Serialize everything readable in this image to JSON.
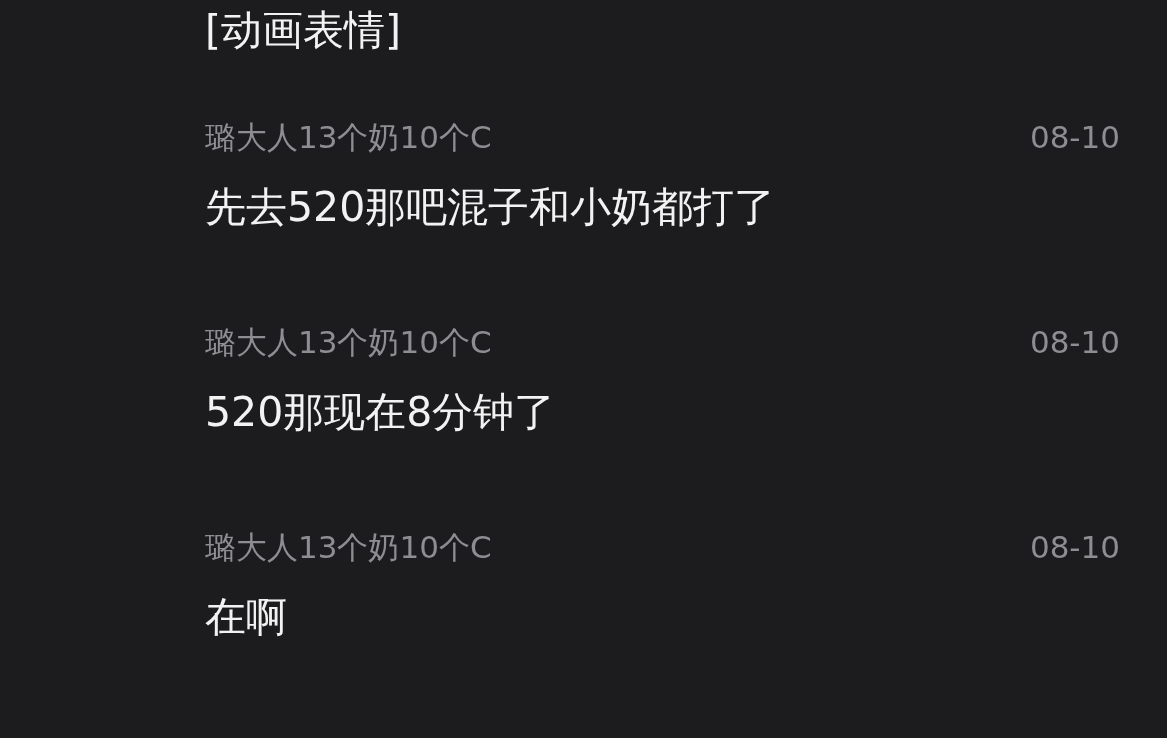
{
  "messages": [
    {
      "text": "[动画表情]"
    },
    {
      "sender": "璐大人13个奶10个C",
      "time": "08-10",
      "text": "先去520那吧混子和小奶都打了"
    },
    {
      "sender": "璐大人13个奶10个C",
      "time": "08-10",
      "text": "520那现在8分钟了"
    },
    {
      "sender": "璐大人13个奶10个C",
      "time": "08-10",
      "text": "在啊"
    }
  ]
}
